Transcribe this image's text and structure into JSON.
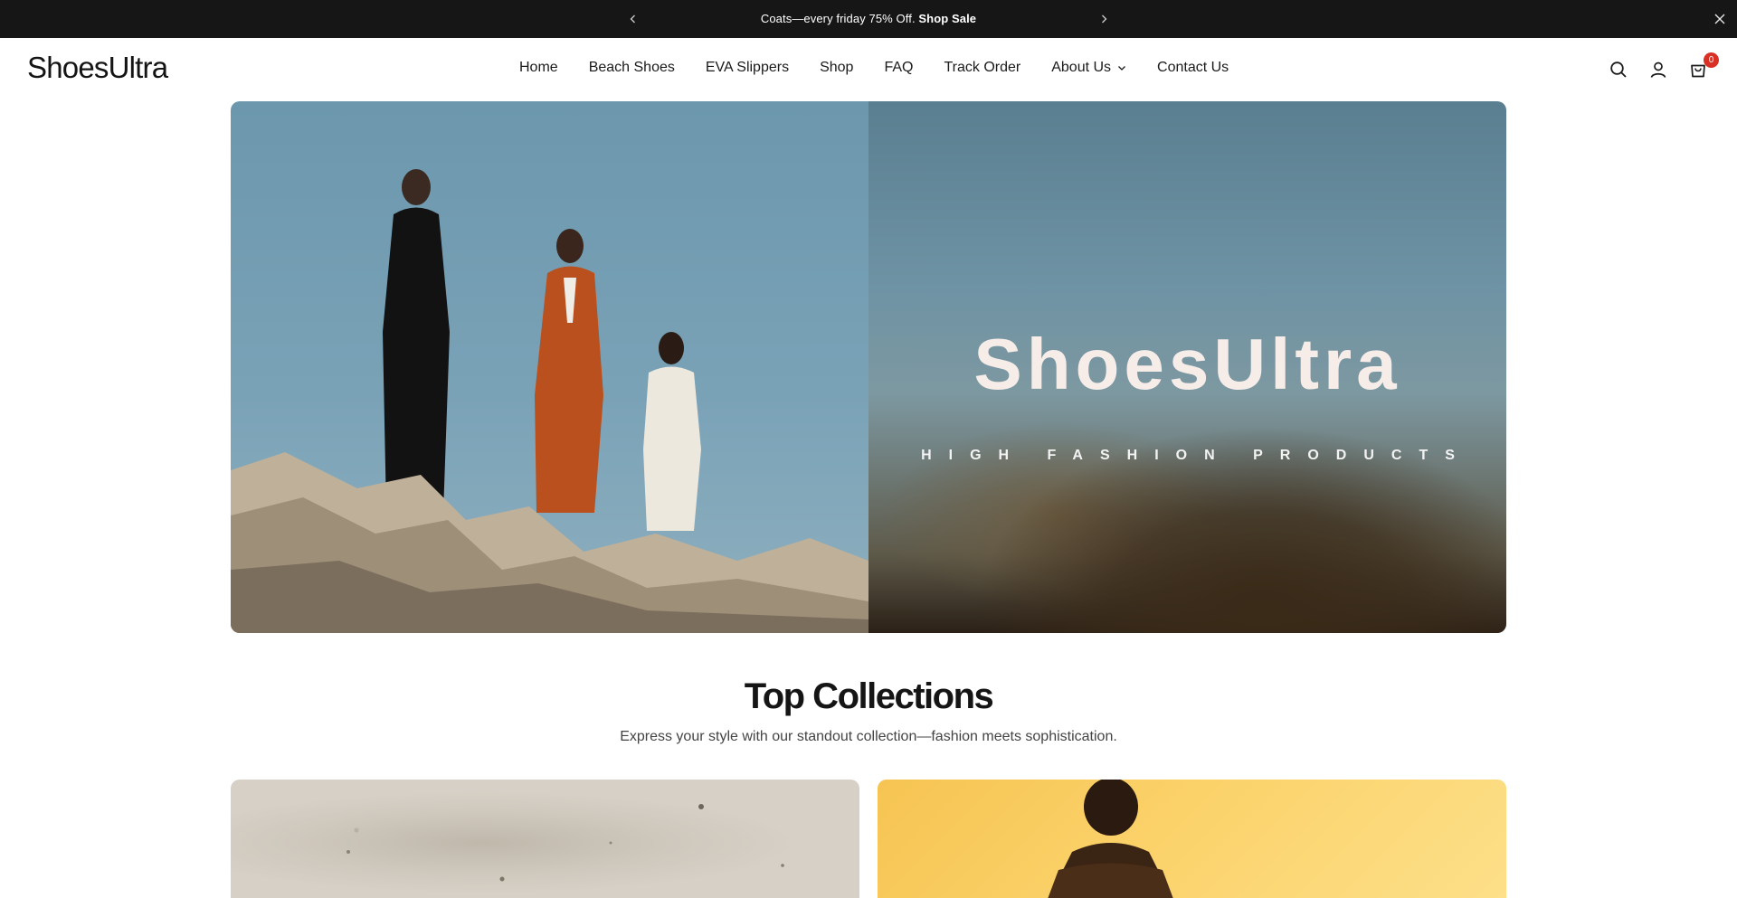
{
  "announcement": {
    "text": "Coats—every friday 75% Off.",
    "link": "Shop Sale"
  },
  "header": {
    "logo": "ShoesUltra",
    "nav": [
      {
        "label": "Home"
      },
      {
        "label": "Beach Shoes"
      },
      {
        "label": "EVA Slippers"
      },
      {
        "label": "Shop"
      },
      {
        "label": "FAQ"
      },
      {
        "label": "Track Order"
      },
      {
        "label": "About Us",
        "has_dropdown": true
      },
      {
        "label": "Contact Us"
      }
    ],
    "icons": [
      "search-icon",
      "account-icon",
      "cart-icon"
    ],
    "cart_count": "0"
  },
  "hero": {
    "title": "ShoesUltra",
    "subtitle": "HIGH FASHION PRODUCTS"
  },
  "collections": {
    "title": "Top Collections",
    "subtitle": "Express your style with our standout collection—fashion meets sophistication."
  },
  "colors": {
    "announcement_bg": "#161616",
    "badge": "#d93025",
    "hero_sky": "#7aa2b7"
  }
}
